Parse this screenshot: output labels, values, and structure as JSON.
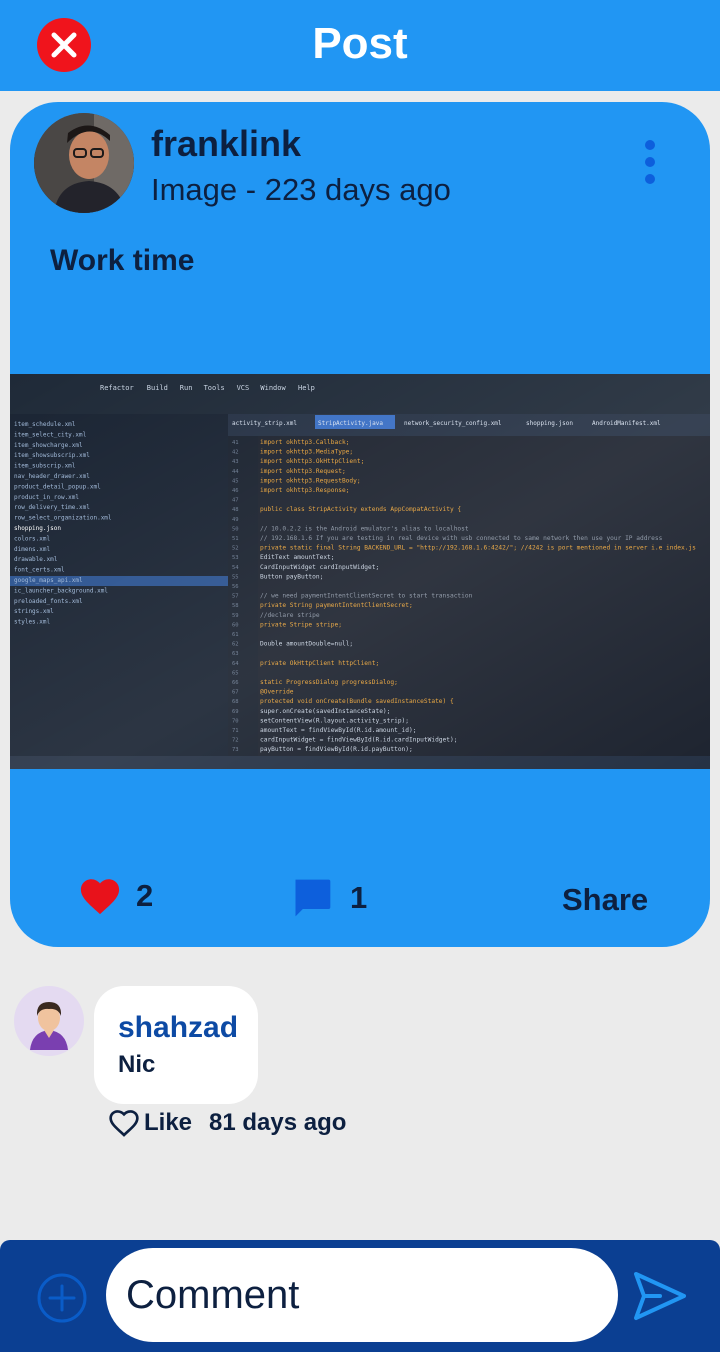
{
  "header": {
    "title": "Post"
  },
  "post": {
    "author": "franklink",
    "meta": "Image - 223 days ago",
    "text": "Work time",
    "likes": "2",
    "comments": "1",
    "share_label": "Share",
    "image": {
      "menu": [
        "Refactor",
        "Build",
        "Run",
        "Tools",
        "VCS",
        "Window",
        "Help"
      ],
      "tabs": [
        "activity_strip.xml",
        "StripActivity.java",
        "network_security_config.xml",
        "shopping.json",
        "AndroidManifest.xml"
      ],
      "files": [
        "item_schedule.xml",
        "item_select_city.xml",
        "item_showcharge.xml",
        "item_showsubscrip.xml",
        "item_subscrip.xml",
        "nav_header_drawer.xml",
        "product_detail_popup.xml",
        "product_in_row.xml",
        "row_delivery_time.xml",
        "row_select_organization.xml",
        "shopping.json",
        "colors.xml",
        "dimens.xml",
        "drawable.xml",
        "font_certs.xml",
        "google_maps_api.xml",
        "ic_launcher_background.xml",
        "preloaded_fonts.xml",
        "strings.xml",
        "styles.xml"
      ],
      "code": [
        "import okhttp3.Callback;",
        "import okhttp3.MediaType;",
        "import okhttp3.OkHttpClient;",
        "import okhttp3.Request;",
        "import okhttp3.RequestBody;",
        "import okhttp3.Response;",
        "",
        "public class StripActivity extends AppCompatActivity {",
        "",
        "    // 10.0.2.2 is the Android emulator's alias to localhost",
        "    // 192.168.1.6 If you are testing in real device with usb connected to same network then use your IP address",
        "    private static final String BACKEND_URL = \"http://192.168.1.6:4242/\"; //4242 is port mentioned in server i.e index.js",
        "    EditText amountText;",
        "    CardInputWidget cardInputWidget;",
        "    Button payButton;",
        "",
        "    // we need paymentIntentClientSecret to start transaction",
        "    private String paymentIntentClientSecret;",
        "    //declare stripe",
        "    private Stripe stripe;",
        "",
        "    Double amountDouble=null;",
        "",
        "    private OkHttpClient httpClient;",
        "",
        "    static ProgressDialog progressDialog;",
        "    @Override",
        "    protected void onCreate(Bundle savedInstanceState) {",
        "        super.onCreate(savedInstanceState);",
        "        setContentView(R.layout.activity_strip);",
        "        amountText = findViewById(R.id.amount_id);",
        "        cardInputWidget = findViewById(R.id.cardInputWidget);",
        "        payButton = findViewById(R.id.payButton);"
      ]
    }
  },
  "comment": {
    "author": "shahzad",
    "text": "Nic",
    "like_label": "Like",
    "time": "81 days ago"
  },
  "composer": {
    "placeholder": "Comment"
  },
  "icons": {
    "close": "close-icon",
    "more": "more-vert-icon",
    "like": "heart-filled-icon",
    "comment": "chat-bubble-icon",
    "comment_like": "heart-outline-icon",
    "add": "add-circle-icon",
    "send": "send-icon"
  },
  "colors": {
    "header": "#2196f3",
    "card": "#2196f3",
    "close": "#f0141c",
    "heart": "#e8121b",
    "comment_icon": "#0d5fdc",
    "text_dark": "#0d2040",
    "comment_author": "#0d4aa4",
    "bottom_bar": "#0b3f92",
    "background": "#ebebeb"
  }
}
